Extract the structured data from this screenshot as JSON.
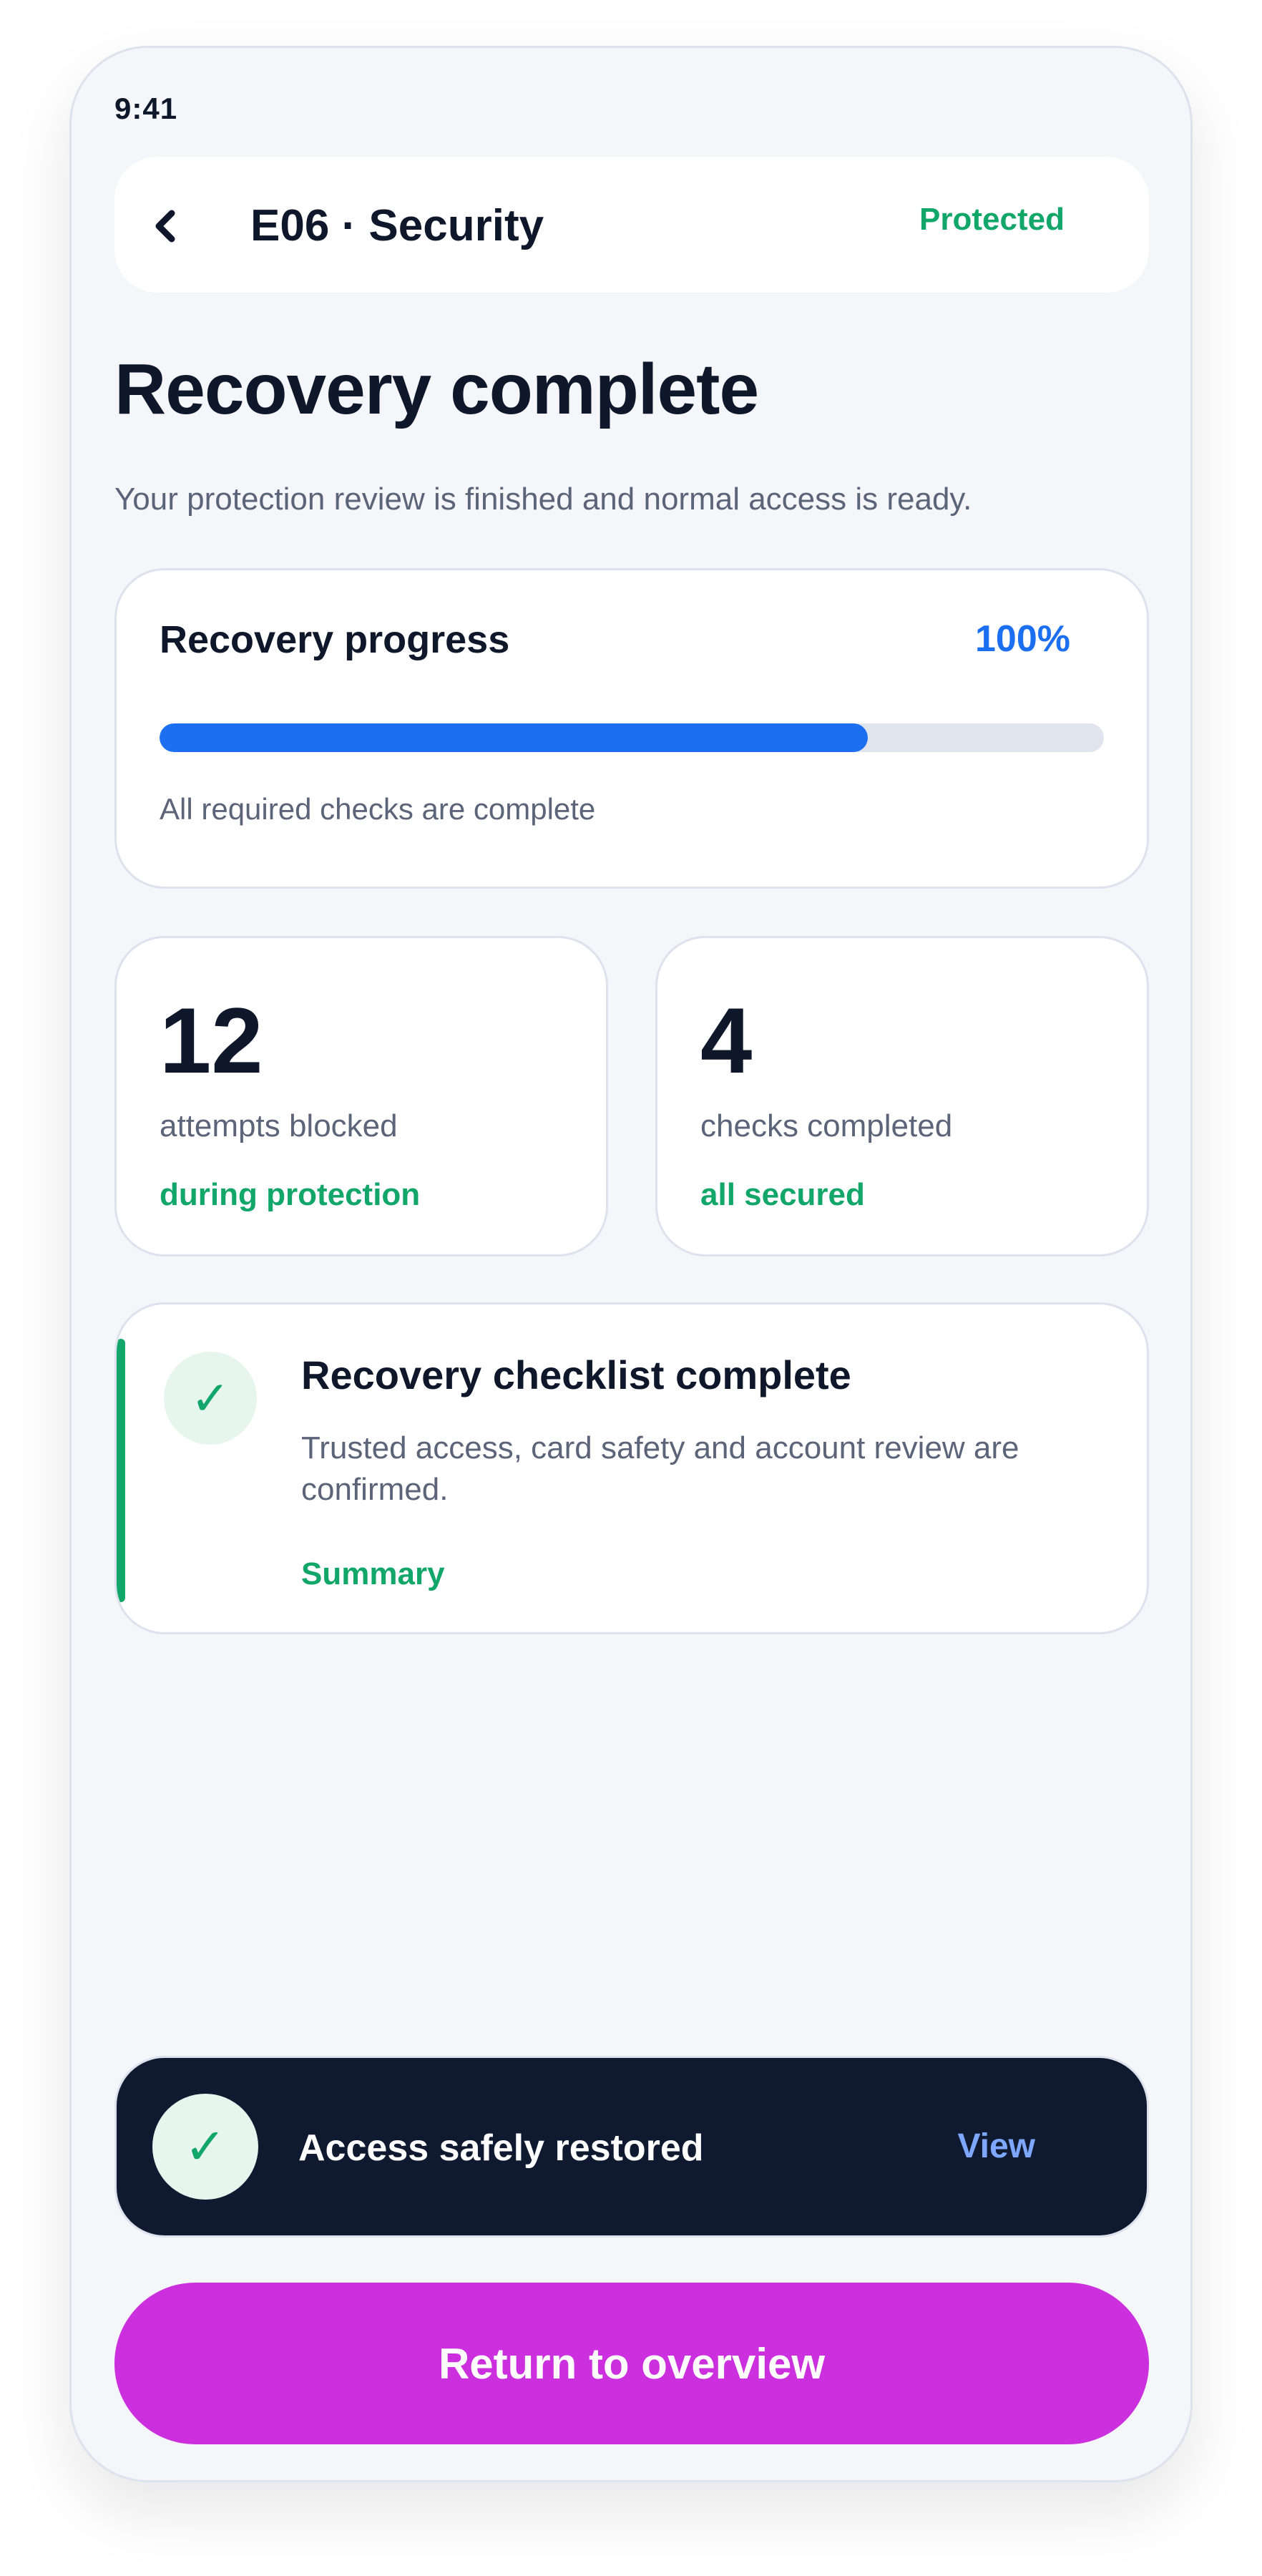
{
  "status_bar": {
    "time": "9:41"
  },
  "header": {
    "back_icon": "chevron-left-icon",
    "title": "E06 · Security",
    "status": "Protected"
  },
  "page": {
    "title": "Recovery complete",
    "subtitle": "Your protection review is finished and normal access is ready."
  },
  "progress": {
    "title": "Recovery progress",
    "value_label": "100%",
    "bar_fraction": 0.75,
    "note": "All required checks are complete"
  },
  "stats": [
    {
      "value": "12",
      "label": "attempts blocked",
      "note": "during protection"
    },
    {
      "value": "4",
      "label": "checks completed",
      "note": "all secured"
    }
  ],
  "checklist": {
    "icon": "check-icon",
    "title": "Recovery checklist complete",
    "body": "Trusted access, card safety and account review are confirmed.",
    "link": "Summary"
  },
  "toast": {
    "icon": "check-icon",
    "text": "Access safely restored",
    "action": "View"
  },
  "primary_action": {
    "label": "Return to overview"
  },
  "colors": {
    "accent_blue": "#1d6ff2",
    "success_green": "#12a66a",
    "primary_button": "#cc2fdd",
    "toast_background": "#0f1a30"
  }
}
